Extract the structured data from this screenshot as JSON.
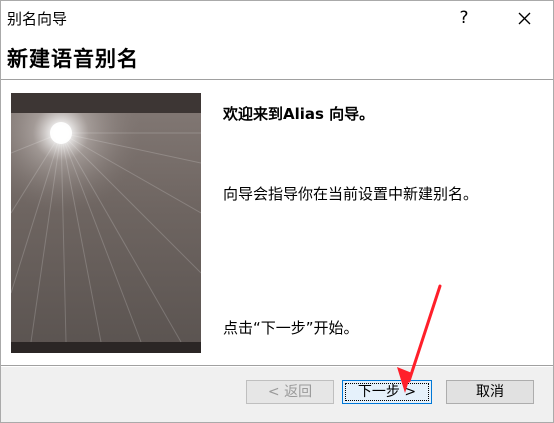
{
  "window": {
    "title": "别名向导",
    "help_label": "?"
  },
  "header": {
    "heading": "新建语音别名"
  },
  "main": {
    "welcome": "欢迎来到Alias 向导。",
    "description": "向导会指导你在当前设置中新建别名。",
    "start_hint": "点击“下一步”开始。"
  },
  "buttons": {
    "back_label": "< 返回",
    "next_label": "下一步 >",
    "cancel_label": "取消"
  },
  "colors": {
    "accent": "#0078d7",
    "annotation_arrow": "#ff1f2a"
  }
}
